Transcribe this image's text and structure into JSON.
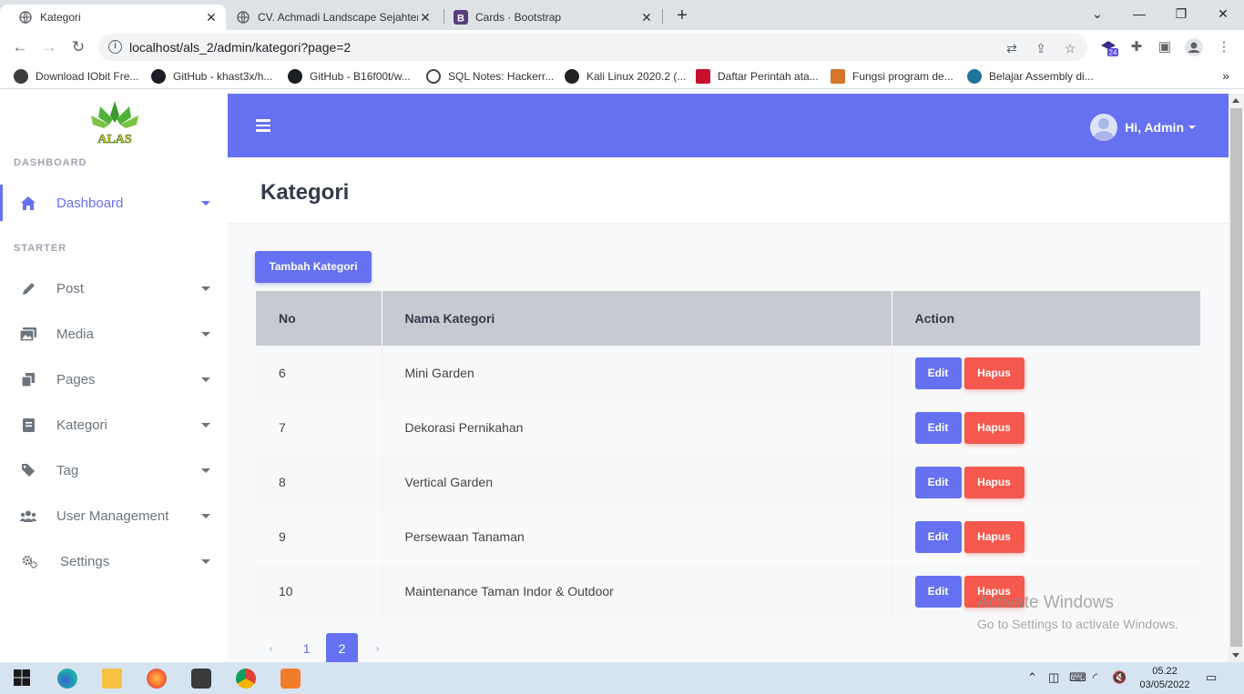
{
  "browser": {
    "tabs": [
      {
        "title": "Kategori",
        "active": true
      },
      {
        "title": "CV. Achmadi Landscape Sejahtera",
        "active": false
      },
      {
        "title": "Cards · Bootstrap",
        "active": false
      }
    ],
    "url": "localhost/als_2/admin/kategori?page=2",
    "extension_badge": "24",
    "bookmarks": [
      "Download IObit Fre...",
      "GitHub - khast3x/h...",
      "GitHub - B16f00t/w...",
      "SQL Notes: Hackerr...",
      "Kali Linux 2020.2 (...",
      "Daftar Perintah ata...",
      "Fungsi program de...",
      "Belajar Assembly di..."
    ]
  },
  "sidebar": {
    "logo_text": "ALAS",
    "section_dashboard": "DASHBOARD",
    "section_starter": "STARTER",
    "items": [
      {
        "label": "Dashboard",
        "icon": "home-icon"
      },
      {
        "label": "Post",
        "icon": "pencil-icon"
      },
      {
        "label": "Media",
        "icon": "images-icon"
      },
      {
        "label": "Pages",
        "icon": "copy-icon"
      },
      {
        "label": "Kategori",
        "icon": "book-icon"
      },
      {
        "label": "Tag",
        "icon": "tag-icon"
      },
      {
        "label": "User Management",
        "icon": "users-icon"
      },
      {
        "label": "Settings",
        "icon": "cogs-icon"
      }
    ]
  },
  "topbar": {
    "greeting": "Hi, Admin"
  },
  "page": {
    "title": "Kategori",
    "add_button": "Tambah Kategori",
    "table": {
      "headers": [
        "No",
        "Nama Kategori",
        "Action"
      ],
      "rows": [
        {
          "no": "6",
          "name": "Mini Garden"
        },
        {
          "no": "7",
          "name": "Dekorasi Pernikahan"
        },
        {
          "no": "8",
          "name": "Vertical Garden"
        },
        {
          "no": "9",
          "name": "Persewaan Tanaman"
        },
        {
          "no": "10",
          "name": "Maintenance Taman Indor & Outdoor"
        }
      ],
      "edit_label": "Edit",
      "delete_label": "Hapus"
    },
    "pagination": {
      "prev": "‹",
      "pages": [
        "1",
        "2"
      ],
      "current": "2",
      "next": "›"
    }
  },
  "watermark": {
    "line1": "Activate Windows",
    "line2": "Go to Settings to activate Windows."
  },
  "taskbar": {
    "time": "05.22",
    "date": "03/05/2022"
  },
  "colors": {
    "accent": "#6571f0",
    "danger": "#f5584c",
    "table_header": "#c8cad1"
  }
}
